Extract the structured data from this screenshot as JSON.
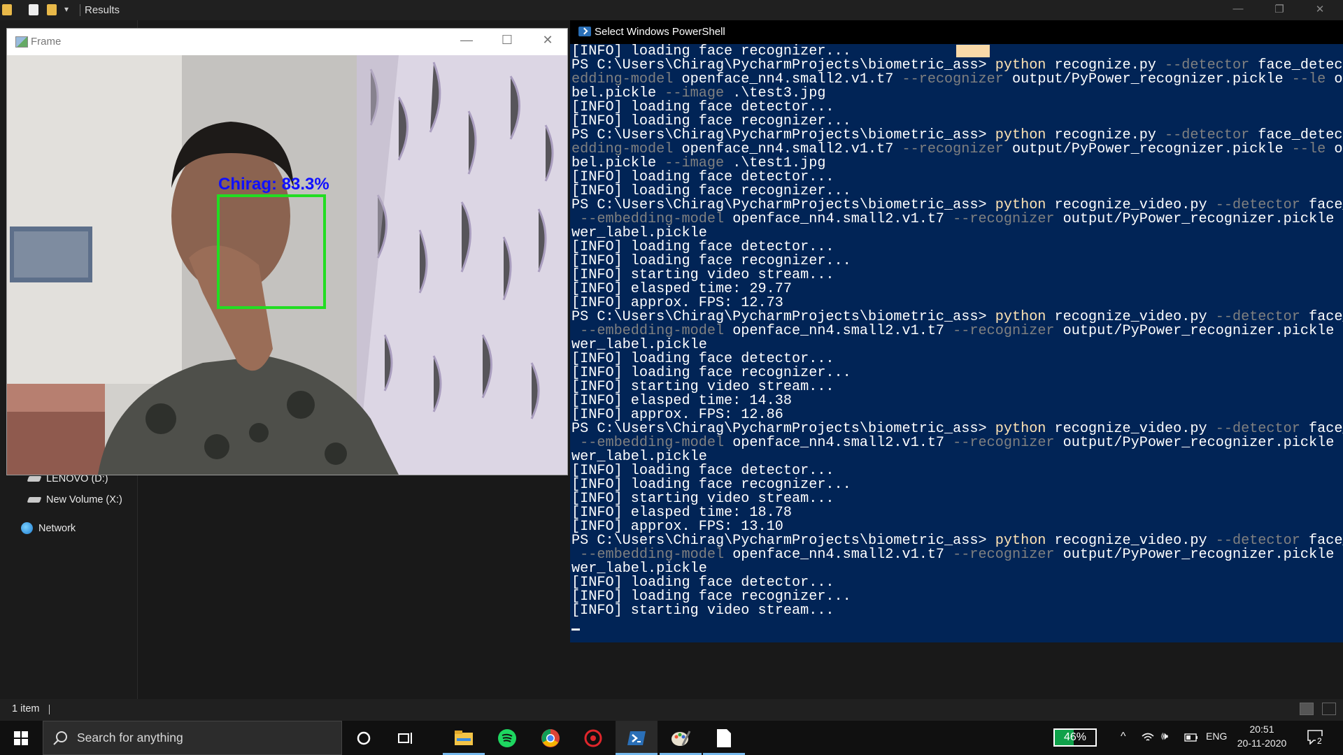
{
  "explorer": {
    "title": "Results",
    "nav_drive_d": "LENOVO (D:)",
    "nav_drive_x": "New Volume (X:)",
    "nav_network": "Network",
    "status_count": "1 item"
  },
  "frame_window": {
    "title": "Frame",
    "detection_label": "Chirag: 83.3%"
  },
  "powershell": {
    "title": "Select Windows PowerShell",
    "lines": [
      [
        {
          "t": "[INFO] loading face recognizer...",
          "c": "cmd"
        }
      ],
      [
        {
          "t": "PS C:\\Users\\Chirag\\PycharmProjects\\biometric_ass> ",
          "c": "cmd"
        },
        {
          "t": "python ",
          "c": "kw"
        },
        {
          "t": "recognize.py ",
          "c": "cmd"
        },
        {
          "t": "--detector ",
          "c": "arg"
        },
        {
          "t": "face_detect",
          "c": "cmd"
        }
      ],
      [
        {
          "t": "edding-model ",
          "c": "arg"
        },
        {
          "t": "openface_nn4.small2.v1.t7 ",
          "c": "cmd"
        },
        {
          "t": "--recognizer ",
          "c": "arg"
        },
        {
          "t": "output/PyPower_recognizer.pickle ",
          "c": "cmd"
        },
        {
          "t": "--le ",
          "c": "arg"
        },
        {
          "t": "ou",
          "c": "cmd"
        }
      ],
      [
        {
          "t": "bel.pickle ",
          "c": "cmd"
        },
        {
          "t": "--image ",
          "c": "arg"
        },
        {
          "t": ".\\test3.jpg",
          "c": "cmd"
        }
      ],
      [
        {
          "t": "[INFO] loading face detector...",
          "c": "cmd"
        }
      ],
      [
        {
          "t": "[INFO] loading face recognizer...",
          "c": "cmd"
        }
      ],
      [
        {
          "t": "PS C:\\Users\\Chirag\\PycharmProjects\\biometric_ass> ",
          "c": "cmd"
        },
        {
          "t": "python ",
          "c": "kw"
        },
        {
          "t": "recognize.py ",
          "c": "cmd"
        },
        {
          "t": "--detector ",
          "c": "arg"
        },
        {
          "t": "face_detect",
          "c": "cmd"
        }
      ],
      [
        {
          "t": "edding-model ",
          "c": "arg"
        },
        {
          "t": "openface_nn4.small2.v1.t7 ",
          "c": "cmd"
        },
        {
          "t": "--recognizer ",
          "c": "arg"
        },
        {
          "t": "output/PyPower_recognizer.pickle ",
          "c": "cmd"
        },
        {
          "t": "--le ",
          "c": "arg"
        },
        {
          "t": "ou",
          "c": "cmd"
        }
      ],
      [
        {
          "t": "bel.pickle ",
          "c": "cmd"
        },
        {
          "t": "--image ",
          "c": "arg"
        },
        {
          "t": ".\\test1.jpg",
          "c": "cmd"
        }
      ],
      [
        {
          "t": "[INFO] loading face detector...",
          "c": "cmd"
        }
      ],
      [
        {
          "t": "[INFO] loading face recognizer...",
          "c": "cmd"
        }
      ],
      [
        {
          "t": "PS C:\\Users\\Chirag\\PycharmProjects\\biometric_ass> ",
          "c": "cmd"
        },
        {
          "t": "python ",
          "c": "kw"
        },
        {
          "t": "recognize_video.py ",
          "c": "cmd"
        },
        {
          "t": "--detector ",
          "c": "arg"
        },
        {
          "t": "face_",
          "c": "cmd"
        }
      ],
      [
        {
          "t": " --embedding-model ",
          "c": "arg"
        },
        {
          "t": "openface_nn4.small2.v1.t7 ",
          "c": "cmd"
        },
        {
          "t": "--recognizer ",
          "c": "arg"
        },
        {
          "t": "output/PyPower_recognizer.pickle ",
          "c": "cmd"
        },
        {
          "t": "-",
          "c": "arg"
        }
      ],
      [
        {
          "t": "wer_label.pickle",
          "c": "cmd"
        }
      ],
      [
        {
          "t": "[INFO] loading face detector...",
          "c": "cmd"
        }
      ],
      [
        {
          "t": "[INFO] loading face recognizer...",
          "c": "cmd"
        }
      ],
      [
        {
          "t": "[INFO] starting video stream...",
          "c": "cmd"
        }
      ],
      [
        {
          "t": "[INFO] elasped time: 29.77",
          "c": "cmd"
        }
      ],
      [
        {
          "t": "[INFO] approx. FPS: 12.73",
          "c": "cmd"
        }
      ],
      [
        {
          "t": "PS C:\\Users\\Chirag\\PycharmProjects\\biometric_ass> ",
          "c": "cmd"
        },
        {
          "t": "python ",
          "c": "kw"
        },
        {
          "t": "recognize_video.py ",
          "c": "cmd"
        },
        {
          "t": "--detector ",
          "c": "arg"
        },
        {
          "t": "face_",
          "c": "cmd"
        }
      ],
      [
        {
          "t": " --embedding-model ",
          "c": "arg"
        },
        {
          "t": "openface_nn4.small2.v1.t7 ",
          "c": "cmd"
        },
        {
          "t": "--recognizer ",
          "c": "arg"
        },
        {
          "t": "output/PyPower_recognizer.pickle ",
          "c": "cmd"
        },
        {
          "t": "-",
          "c": "arg"
        }
      ],
      [
        {
          "t": "wer_label.pickle",
          "c": "cmd"
        }
      ],
      [
        {
          "t": "[INFO] loading face detector...",
          "c": "cmd"
        }
      ],
      [
        {
          "t": "[INFO] loading face recognizer...",
          "c": "cmd"
        }
      ],
      [
        {
          "t": "[INFO] starting video stream...",
          "c": "cmd"
        }
      ],
      [
        {
          "t": "[INFO] elasped time: 14.38",
          "c": "cmd"
        }
      ],
      [
        {
          "t": "[INFO] approx. FPS: 12.86",
          "c": "cmd"
        }
      ],
      [
        {
          "t": "PS C:\\Users\\Chirag\\PycharmProjects\\biometric_ass> ",
          "c": "cmd"
        },
        {
          "t": "python ",
          "c": "kw"
        },
        {
          "t": "recognize_video.py ",
          "c": "cmd"
        },
        {
          "t": "--detector ",
          "c": "arg"
        },
        {
          "t": "face_",
          "c": "cmd"
        }
      ],
      [
        {
          "t": " --embedding-model ",
          "c": "arg"
        },
        {
          "t": "openface_nn4.small2.v1.t7 ",
          "c": "cmd"
        },
        {
          "t": "--recognizer ",
          "c": "arg"
        },
        {
          "t": "output/PyPower_recognizer.pickle ",
          "c": "cmd"
        },
        {
          "t": "-",
          "c": "arg"
        }
      ],
      [
        {
          "t": "wer_label.pickle",
          "c": "cmd"
        }
      ],
      [
        {
          "t": "[INFO] loading face detector...",
          "c": "cmd"
        }
      ],
      [
        {
          "t": "[INFO] loading face recognizer...",
          "c": "cmd"
        }
      ],
      [
        {
          "t": "[INFO] starting video stream...",
          "c": "cmd"
        }
      ],
      [
        {
          "t": "[INFO] elasped time: 18.78",
          "c": "cmd"
        }
      ],
      [
        {
          "t": "[INFO] approx. FPS: 13.10",
          "c": "cmd"
        }
      ],
      [
        {
          "t": "PS C:\\Users\\Chirag\\PycharmProjects\\biometric_ass> ",
          "c": "cmd"
        },
        {
          "t": "python ",
          "c": "kw"
        },
        {
          "t": "recognize_video.py ",
          "c": "cmd"
        },
        {
          "t": "--detector ",
          "c": "arg"
        },
        {
          "t": "face_",
          "c": "cmd"
        }
      ],
      [
        {
          "t": " --embedding-model ",
          "c": "arg"
        },
        {
          "t": "openface_nn4.small2.v1.t7 ",
          "c": "cmd"
        },
        {
          "t": "--recognizer ",
          "c": "arg"
        },
        {
          "t": "output/PyPower_recognizer.pickle ",
          "c": "cmd"
        },
        {
          "t": "-",
          "c": "arg"
        }
      ],
      [
        {
          "t": "wer_label.pickle",
          "c": "cmd"
        }
      ],
      [
        {
          "t": "[INFO] loading face detector...",
          "c": "cmd"
        }
      ],
      [
        {
          "t": "[INFO] loading face recognizer...",
          "c": "cmd"
        }
      ],
      [
        {
          "t": "[INFO] starting video stream...",
          "c": "cmd"
        }
      ]
    ]
  },
  "taskbar": {
    "search_placeholder": "Search for anything",
    "battery_percent": "46%",
    "battery_level": 0.46,
    "language": "ENG",
    "time": "20:51",
    "date": "20-11-2020",
    "notification_count": "2"
  },
  "colors": {
    "powershell_bg": "#012456",
    "detection_box": "#22dd22",
    "detection_label": "#1010ff",
    "taskbar_accent": "#76b9ed"
  }
}
